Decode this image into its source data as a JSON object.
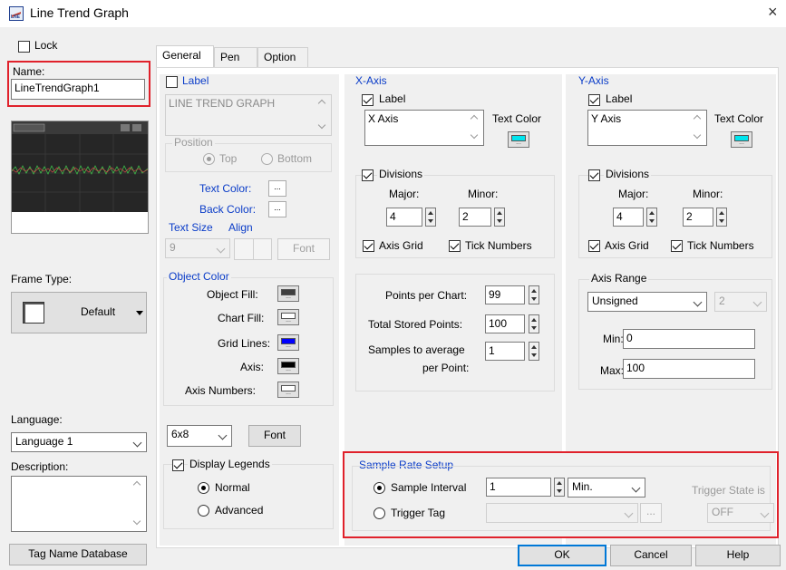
{
  "window": {
    "title": "Line Trend Graph",
    "close_glyph": "×"
  },
  "left": {
    "lock_label": "Lock",
    "name_label": "Name:",
    "name_value": "LineTrendGraph1",
    "frame_type_label": "Frame Type:",
    "frame_type_value": "Default",
    "language_label": "Language:",
    "language_value": "Language 1",
    "description_label": "Description:",
    "tag_db_button": "Tag Name Database"
  },
  "tabs": [
    "General",
    "Pen",
    "Option"
  ],
  "general": {
    "label_check": "Label",
    "label_text": "LINE TREND GRAPH",
    "position_title": "Position",
    "position_top": "Top",
    "position_bottom": "Bottom",
    "text_color_label": "Text Color:",
    "back_color_label": "Back Color:",
    "text_size_label": "Text Size",
    "align_label": "Align",
    "text_size_value": "9",
    "font_button": "Font",
    "object_color_title": "Object Color",
    "object_fill_label": "Object Fill:",
    "chart_fill_label": "Chart Fill:",
    "grid_lines_label": "Grid Lines:",
    "axis_label": "Axis:",
    "axis_numbers_label": "Axis Numbers:",
    "font_size_value": "6x8",
    "font_button2": "Font",
    "display_legends": "Display Legends",
    "normal": "Normal",
    "advanced": "Advanced",
    "colors": {
      "object_fill": "#404040",
      "chart_fill": "#ffffff",
      "grid_lines": "#0000ff",
      "axis": "#000000",
      "axis_numbers": "#ffffff"
    }
  },
  "x_axis": {
    "title": "X-Axis",
    "label_check": "Label",
    "label_text": "X Axis",
    "text_color_label": "Text Color",
    "text_color": "#00e5ee",
    "divisions": "Divisions",
    "major_label": "Major:",
    "minor_label": "Minor:",
    "major_value": "4",
    "minor_value": "2",
    "axis_grid": "Axis Grid",
    "tick_numbers": "Tick Numbers",
    "points_per_chart_label": "Points per Chart:",
    "points_per_chart": "99",
    "total_stored_label": "Total Stored Points:",
    "total_stored": "100",
    "samples_avg_label_1": "Samples to average",
    "samples_avg_label_2": "per Point:",
    "samples_avg": "1"
  },
  "y_axis": {
    "title": "Y-Axis",
    "label_check": "Label",
    "label_text": "Y Axis",
    "text_color_label": "Text Color",
    "text_color": "#00e5ee",
    "divisions": "Divisions",
    "major_label": "Major:",
    "minor_label": "Minor:",
    "major_value": "4",
    "minor_value": "2",
    "axis_grid": "Axis Grid",
    "tick_numbers": "Tick Numbers",
    "axis_range_title": "Axis Range",
    "range_type": "Unsigned",
    "range_extra": "2",
    "min_label": "Min:",
    "min_value": "0",
    "max_label": "Max:",
    "max_value": "100"
  },
  "sample_rate": {
    "title": "Sample Rate Setup",
    "sample_interval": "Sample Interval",
    "interval_value": "1",
    "interval_unit": "Min.",
    "trigger_tag": "Trigger Tag",
    "trigger_state_label": "Trigger State is",
    "trigger_state_value": "OFF",
    "dots": "..."
  },
  "footer": {
    "ok": "OK",
    "cancel": "Cancel",
    "help": "Help"
  }
}
